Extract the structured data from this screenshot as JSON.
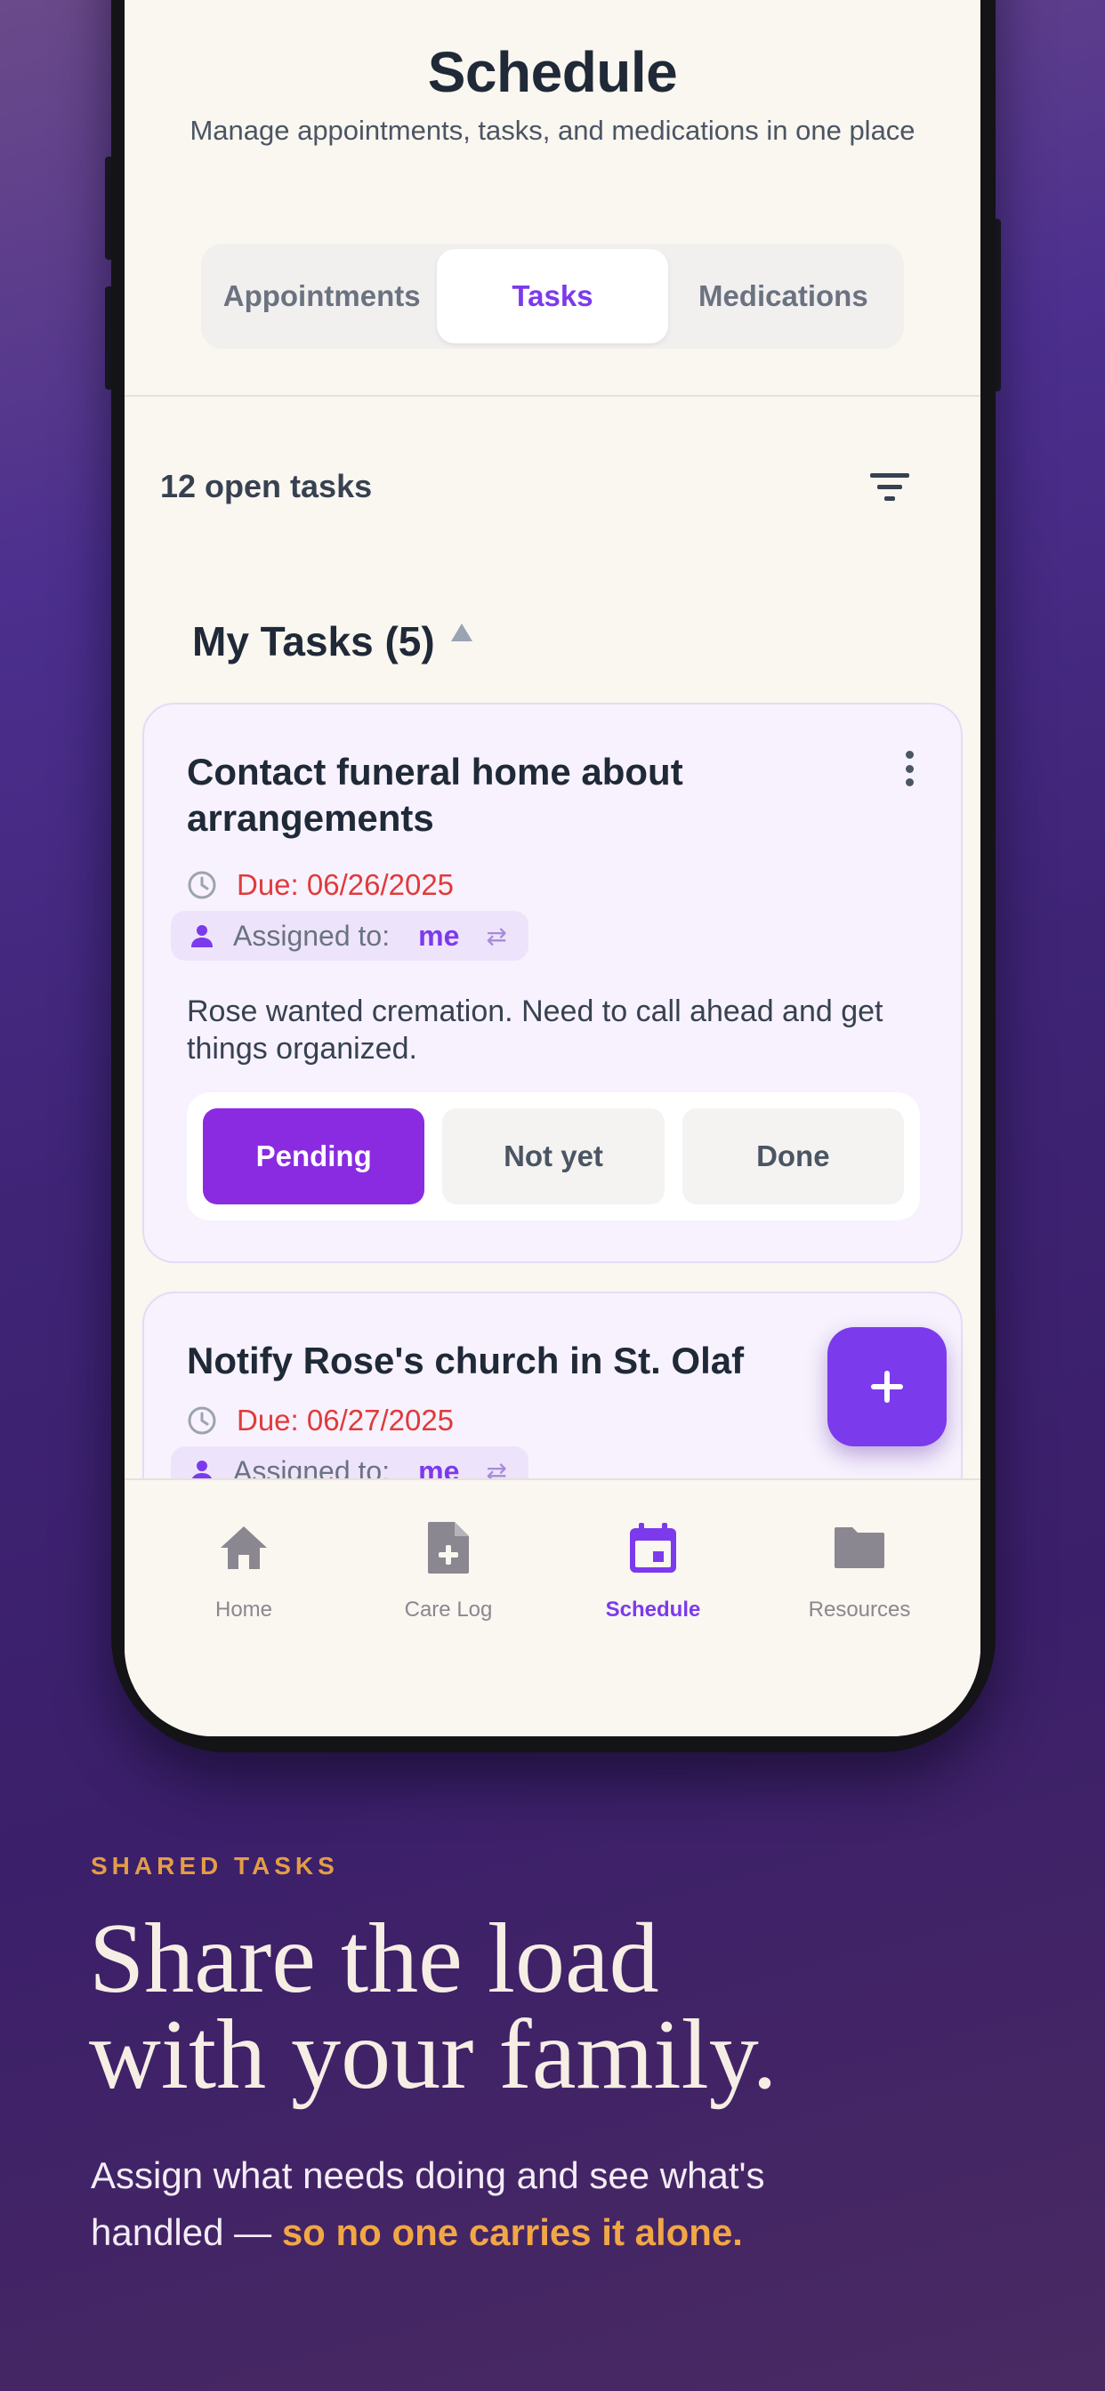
{
  "header": {
    "title": "Schedule",
    "subtitle": "Manage appointments, tasks, and medications in one place"
  },
  "tabs": [
    {
      "label": "Appointments",
      "active": false
    },
    {
      "label": "Tasks",
      "active": true
    },
    {
      "label": "Medications",
      "active": false
    }
  ],
  "list": {
    "open_count": "12 open tasks",
    "filter_icon": "filter-icon",
    "section_title": "My Tasks (5)"
  },
  "tasks": [
    {
      "title": "Contact funeral home about arrangements",
      "due": "Due: 06/26/2025",
      "assigned_label": "Assigned to:",
      "assignee": "me",
      "note": "Rose wanted cremation. Need to call ahead and get things organized.",
      "statuses": [
        "Pending",
        "Not yet",
        "Done"
      ],
      "selected_status": "Pending"
    },
    {
      "title": "Notify Rose's church in St. Olaf",
      "due": "Due: 06/27/2025",
      "assigned_label": "Assigned to:",
      "assignee": "me"
    }
  ],
  "fab": {
    "icon": "plus-icon"
  },
  "bottom_nav": [
    {
      "label": "Home",
      "icon": "home-icon",
      "active": false
    },
    {
      "label": "Care Log",
      "icon": "note-add-icon",
      "active": false
    },
    {
      "label": "Schedule",
      "icon": "calendar-icon",
      "active": true
    },
    {
      "label": "Resources",
      "icon": "folder-icon",
      "active": false
    }
  ],
  "marketing": {
    "eyebrow": "SHARED TASKS",
    "headline_line1": "Share the load",
    "headline_line2": "with your family.",
    "body_line1": "Assign what needs doing and see what's",
    "body_line2_prefix": "handled — ",
    "body_highlight": "so no one carries it alone."
  },
  "colors": {
    "accent": "#7c3aed",
    "due_red": "#e03b3b",
    "eyebrow_orange": "#e39d45",
    "screen_bg": "#faf6f0"
  }
}
